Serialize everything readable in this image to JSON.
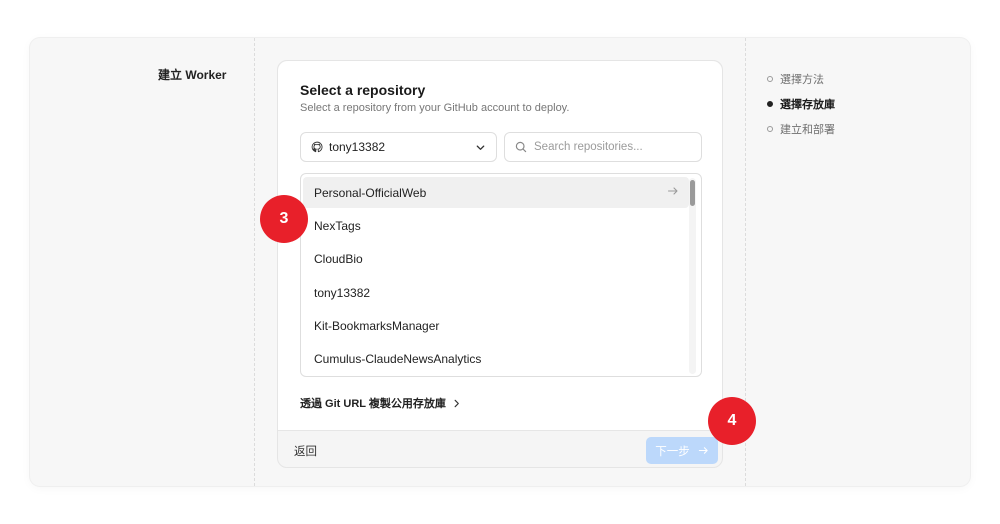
{
  "page": {
    "title": "建立 Worker"
  },
  "steps": [
    {
      "label": "選擇方法",
      "active": false
    },
    {
      "label": "選擇存放庫",
      "active": true
    },
    {
      "label": "建立和部署",
      "active": false
    }
  ],
  "card": {
    "title": "Select a repository",
    "subtitle": "Select a repository from your GitHub account to deploy."
  },
  "owner_select": {
    "value": "tony13382",
    "icon": "github-icon"
  },
  "search": {
    "placeholder": "Search repositories..."
  },
  "repositories": [
    "Personal-OfficialWeb",
    "NexTags",
    "CloudBio",
    "tony13382",
    "Kit-BookmarksManager",
    "Cumulus-ClaudeNewsAnalytics"
  ],
  "git_url_link": "透過 Git URL 複製公用存放庫",
  "footer": {
    "back": "返回",
    "next": "下一步"
  },
  "annotations": {
    "badge_3": "3",
    "badge_4": "4"
  },
  "colors": {
    "accent_disabled": "#bcd8fb",
    "badge": "#e8202a"
  }
}
